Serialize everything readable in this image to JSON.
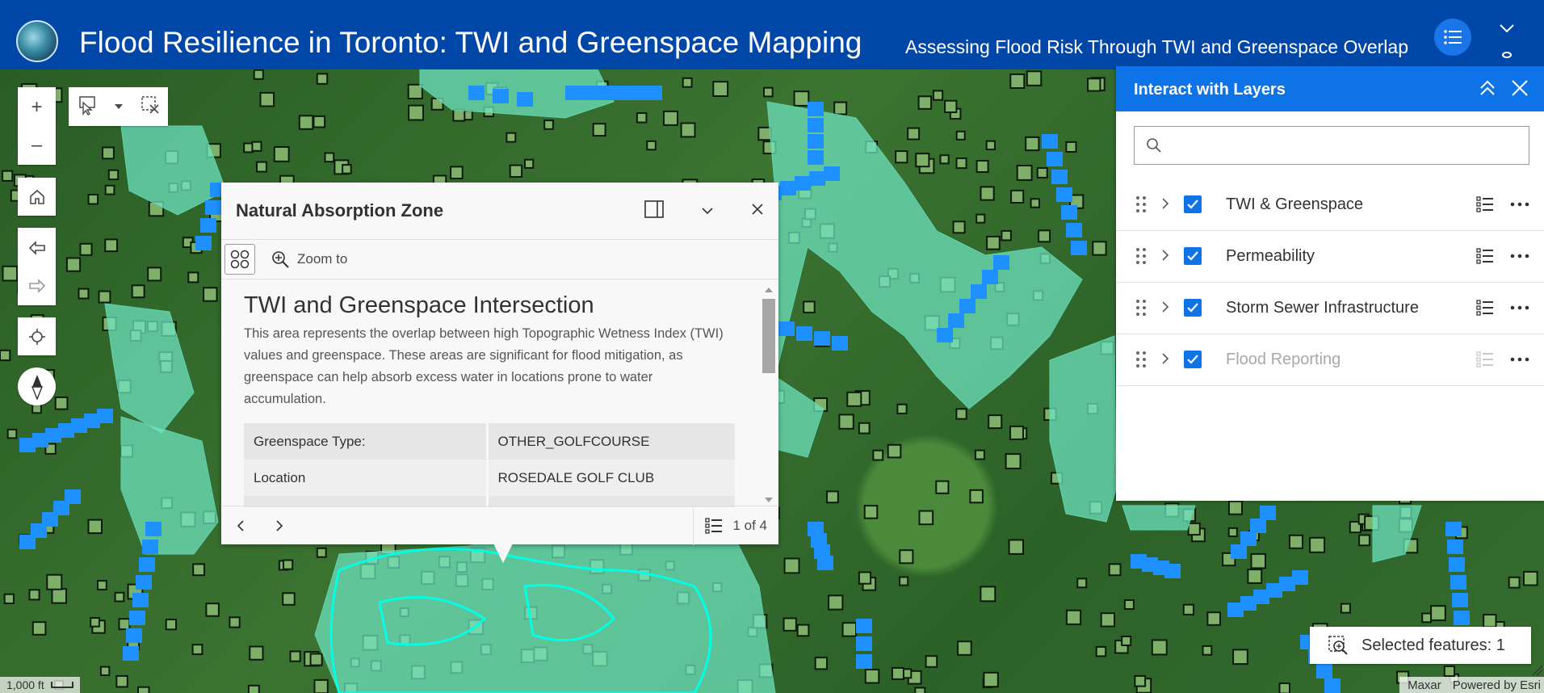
{
  "header": {
    "title": "Flood Resilience in Toronto: TWI and Greenspace Mapping",
    "subtitle": "Assessing Flood Risk Through TWI and Greenspace Overlap"
  },
  "colors": {
    "header_bg": "#0047a7",
    "accent": "#0f73e8",
    "greenspace_fill": "#6fe6c2",
    "twi_cells": "#1e90ff",
    "selection_outline": "#00ffe6"
  },
  "map_tools": {
    "zoom_in": "+",
    "zoom_out": "–"
  },
  "popup": {
    "title": "Natural Absorption Zone",
    "zoom_to_label": "Zoom to",
    "section_title": "TWI and Greenspace Intersection",
    "description": "This area represents the overlap between high Topographic Wetness Index (TWI) values and greenspace. These areas are significant for flood mitigation, as greenspace can help absorb excess water in locations prone to water accumulation.",
    "attributes": [
      {
        "label": "Greenspace Type:",
        "value": "OTHER_GOLFCOURSE"
      },
      {
        "label": "Location",
        "value": "ROSEDALE GOLF CLUB"
      }
    ],
    "pager_text": "1 of 4"
  },
  "layers_panel": {
    "title": "Interact with Layers",
    "search_placeholder": "",
    "layers": [
      {
        "name": "TWI & Greenspace",
        "visible": true,
        "dimmed": false
      },
      {
        "name": "Permeability",
        "visible": true,
        "dimmed": false
      },
      {
        "name": "Storm Sewer Infrastructure",
        "visible": true,
        "dimmed": false
      },
      {
        "name": "Flood Reporting",
        "visible": true,
        "dimmed": true
      }
    ]
  },
  "selected_features": {
    "label": "Selected features: 1"
  },
  "footer": {
    "scale_label": "1,000 ft",
    "attribution_source": "Maxar",
    "attribution_powered": "Powered by Esri"
  }
}
